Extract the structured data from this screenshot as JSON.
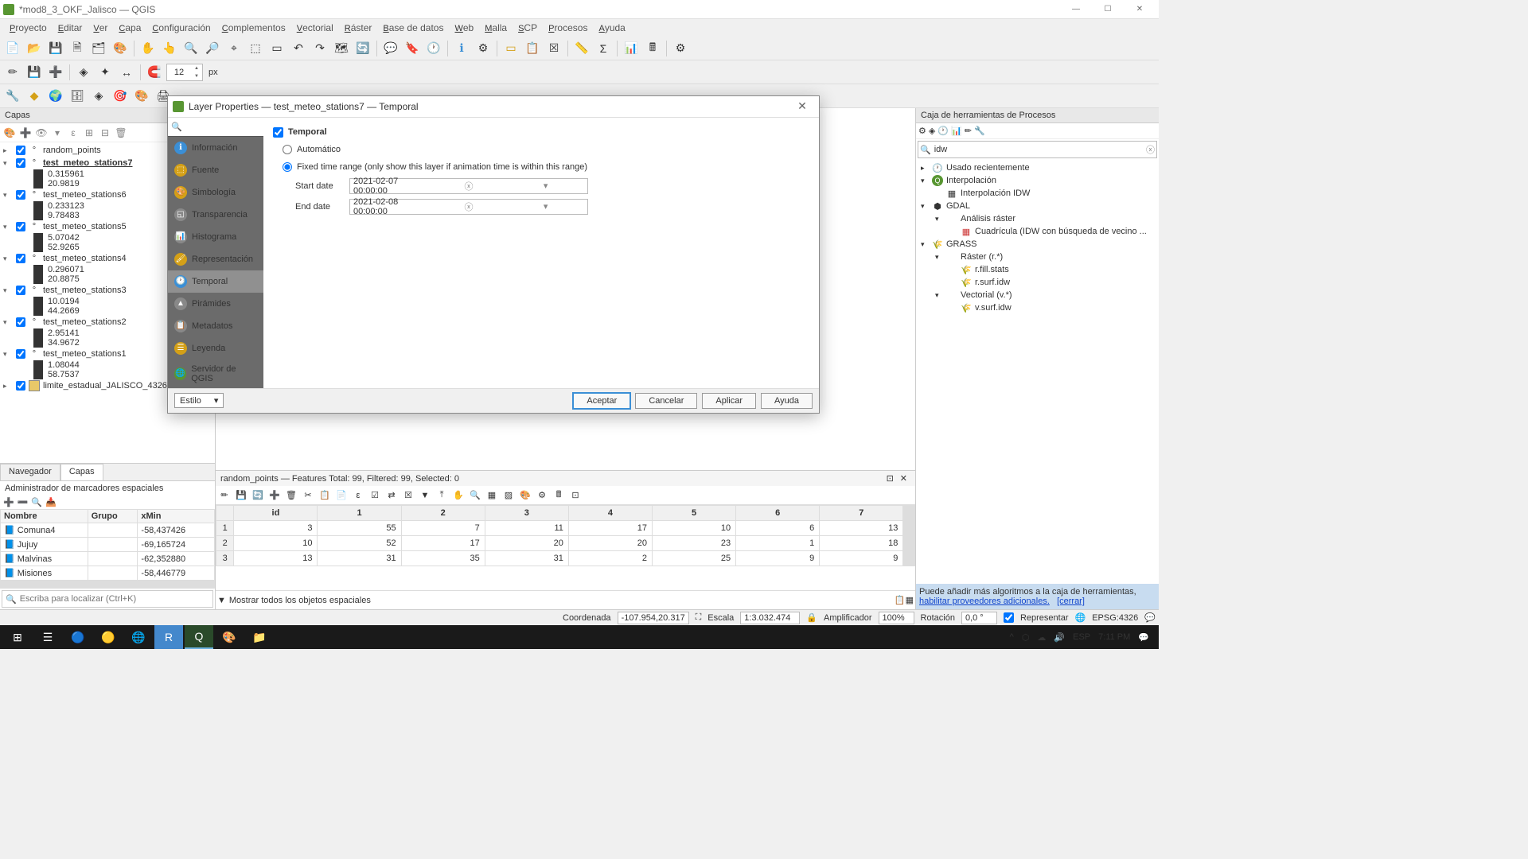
{
  "window": {
    "title": "*mod8_3_OKF_Jalisco — QGIS"
  },
  "menu": [
    "Proyecto",
    "Editar",
    "Ver",
    "Capa",
    "Configuración",
    "Complementos",
    "Vectorial",
    "Ráster",
    "Base de datos",
    "Web",
    "Malla",
    "SCP",
    "Procesos",
    "Ayuda"
  ],
  "spin": {
    "value": "12",
    "unit": "px"
  },
  "layers_panel": {
    "title": "Capas",
    "layers": [
      {
        "name": "random_points",
        "expanded": false,
        "sel": false
      },
      {
        "name": "test_meteo_stations7",
        "expanded": true,
        "sel": true,
        "sub": [
          "0.315961",
          "20.9819"
        ]
      },
      {
        "name": "test_meteo_stations6",
        "expanded": true,
        "sel": false,
        "sub": [
          "0.233123",
          "9.78483"
        ]
      },
      {
        "name": "test_meteo_stations5",
        "expanded": true,
        "sel": false,
        "sub": [
          "5.07042",
          "52.9265"
        ]
      },
      {
        "name": "test_meteo_stations4",
        "expanded": true,
        "sel": false,
        "sub": [
          "0.296071",
          "20.8875"
        ]
      },
      {
        "name": "test_meteo_stations3",
        "expanded": true,
        "sel": false,
        "sub": [
          "10.0194",
          "44.2669"
        ]
      },
      {
        "name": "test_meteo_stations2",
        "expanded": true,
        "sel": false,
        "sub": [
          "2.95141",
          "34.9672"
        ]
      },
      {
        "name": "test_meteo_stations1",
        "expanded": true,
        "sel": false,
        "sub": [
          "1.08044",
          "58.7537"
        ]
      },
      {
        "name": "limite_estadual_JALISCO_4326",
        "expanded": false,
        "sel": false,
        "poly": true
      }
    ]
  },
  "tabs": {
    "navegador": "Navegador",
    "capas": "Capas"
  },
  "bookmarks": {
    "title": "Administrador de marcadores espaciales",
    "headers": [
      "Nombre",
      "Grupo",
      "xMin"
    ],
    "rows": [
      {
        "name": "Comuna4",
        "grupo": "",
        "xmin": "-58,437426"
      },
      {
        "name": "Jujuy",
        "grupo": "",
        "xmin": "-69,165724"
      },
      {
        "name": "Malvinas",
        "grupo": "",
        "xmin": "-62,352880"
      },
      {
        "name": "Misiones",
        "grupo": "",
        "xmin": "-58,446779"
      }
    ]
  },
  "locator_placeholder": "Escriba para localizar (Ctrl+K)",
  "attr": {
    "title": "random_points — Features Total: 99, Filtered: 99, Selected: 0",
    "headers": [
      "id",
      "1",
      "2",
      "3",
      "4",
      "5",
      "6",
      "7"
    ],
    "rows": [
      {
        "n": "1",
        "c": [
          "3",
          "55",
          "7",
          "11",
          "17",
          "10",
          "6",
          "13"
        ]
      },
      {
        "n": "2",
        "c": [
          "10",
          "52",
          "17",
          "20",
          "20",
          "23",
          "1",
          "18"
        ]
      },
      {
        "n": "3",
        "c": [
          "13",
          "31",
          "35",
          "31",
          "2",
          "25",
          "9",
          "9"
        ]
      }
    ],
    "footer": "Mostrar todos los objetos espaciales"
  },
  "rightpanel": {
    "title": "Caja de herramientas de Procesos",
    "search": "idw",
    "tree": [
      {
        "lvl": 0,
        "exp": "▸",
        "icon": "🕐",
        "txt": "Usado recientemente"
      },
      {
        "lvl": 0,
        "exp": "▾",
        "icon": "Q",
        "txt": "Interpolación",
        "q": true
      },
      {
        "lvl": 1,
        "exp": "",
        "icon": "▦",
        "txt": "Interpolación IDW"
      },
      {
        "lvl": 0,
        "exp": "▾",
        "icon": "⬢",
        "txt": "GDAL"
      },
      {
        "lvl": 1,
        "exp": "▾",
        "icon": "",
        "txt": "Análisis ráster"
      },
      {
        "lvl": 2,
        "exp": "",
        "icon": "▦",
        "txt": "Cuadrícula (IDW con búsqueda de vecino ...",
        "red": true
      },
      {
        "lvl": 0,
        "exp": "▾",
        "icon": "🌾",
        "txt": "GRASS"
      },
      {
        "lvl": 1,
        "exp": "▾",
        "icon": "",
        "txt": "Ráster (r.*)"
      },
      {
        "lvl": 2,
        "exp": "",
        "icon": "🌾",
        "txt": "r.fill.stats"
      },
      {
        "lvl": 2,
        "exp": "",
        "icon": "🌾",
        "txt": "r.surf.idw"
      },
      {
        "lvl": 1,
        "exp": "▾",
        "icon": "",
        "txt": "Vectorial (v.*)"
      },
      {
        "lvl": 2,
        "exp": "",
        "icon": "🌾",
        "txt": "v.surf.idw"
      }
    ],
    "tip_pre": "Puede añadir más algoritmos a la caja de herramientas, ",
    "tip_link1": "habilitar proveedores adicionales.",
    "tip_link2": "[cerrar]"
  },
  "status": {
    "coord_label": "Coordenada",
    "coord": "-107.954,20.317",
    "scale_label": "Escala",
    "scale": "1:3.032.474",
    "mag_label": "Amplificador",
    "mag": "100%",
    "rot_label": "Rotación",
    "rot": "0,0 °",
    "render": "Representar",
    "crs": "EPSG:4326"
  },
  "taskbar": {
    "lang": "ESP",
    "time": "7:11 PM"
  },
  "dialog": {
    "title": "Layer Properties — test_meteo_stations7 — Temporal",
    "side": [
      "Información",
      "Fuente",
      "Simbología",
      "Transparencia",
      "Histograma",
      "Representación",
      "Temporal",
      "Pirámides",
      "Metadatos",
      "Leyenda",
      "Servidor de QGIS"
    ],
    "side_active": 6,
    "check": "Temporal",
    "radio_auto": "Automático",
    "radio_fixed": "Fixed time range (only show this layer if animation time is within this range)",
    "start_label": "Start date",
    "start_val": "2021-02-07 00:00:00",
    "end_label": "End date",
    "end_val": "2021-02-08 00:00:00",
    "style": "Estilo",
    "btn_ok": "Aceptar",
    "btn_cancel": "Cancelar",
    "btn_apply": "Aplicar",
    "btn_help": "Ayuda"
  }
}
